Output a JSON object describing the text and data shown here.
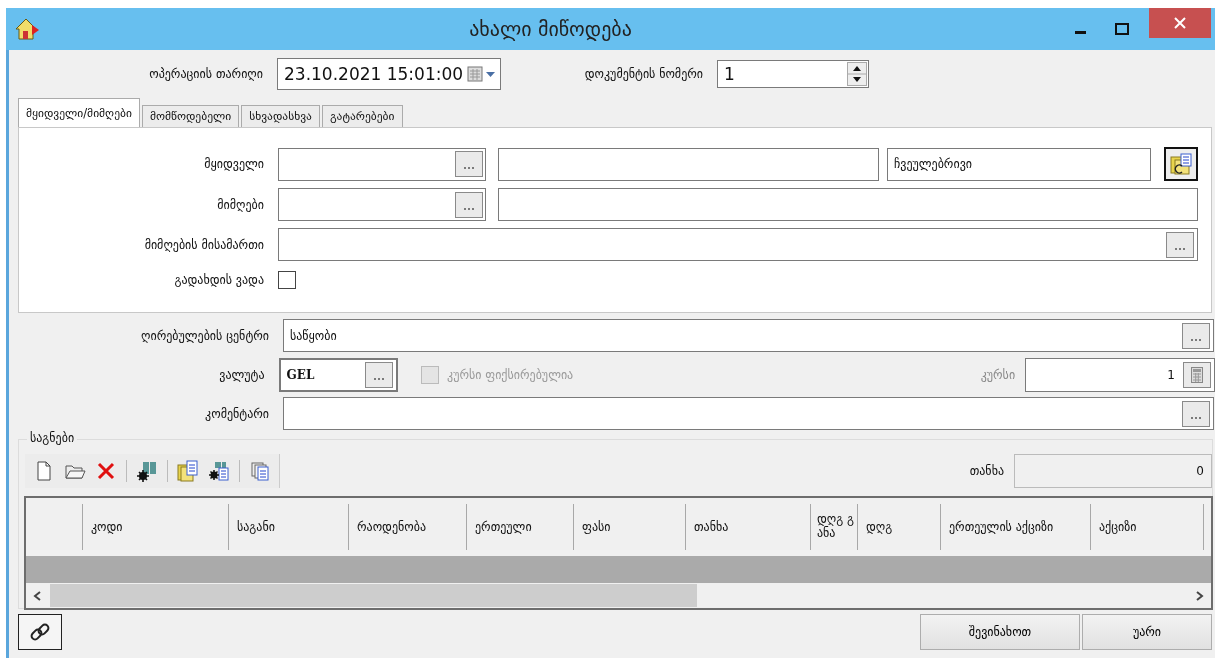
{
  "window": {
    "title": "ახალი მიწოდება"
  },
  "header": {
    "operation_date_label": "ოპერაციის თარიღი",
    "operation_date": "23.10.2021 15:01:00",
    "document_number_label": "დოკუმენტის ნომერი",
    "document_number": "1"
  },
  "tabs": [
    {
      "label": "მყიდველი/მიმღები",
      "selected": true
    },
    {
      "label": "მომწოდებელი",
      "selected": false
    },
    {
      "label": "სხვადასხვა",
      "selected": false
    },
    {
      "label": "გატარებები",
      "selected": false
    }
  ],
  "buyer_tab": {
    "buyer_label": "მყიდველი",
    "buyer_type": "ჩვეულებრივი",
    "receiver_label": "მიმღები",
    "receiver_address_label": "მიმღების მისამართი",
    "payment_term_label": "გადახდის ვადა",
    "payment_term_checked": false
  },
  "cost_center": {
    "label": "ღირებულების ცენტრი",
    "value": "საწყობი"
  },
  "currency": {
    "label": "ვალუტა",
    "value": "GEL",
    "fixed_rate_label": "კურსი ფიქსირებულია",
    "fixed_rate_checked": false,
    "fixed_rate_disabled": true,
    "rate_label": "კურსი",
    "rate": "1"
  },
  "comment": {
    "label": "კომენტარი"
  },
  "items": {
    "title": "საგნები",
    "total_label": "თანხა",
    "total": "0",
    "columns": [
      "კოდი",
      "საგანი",
      "რაოდენობა",
      "ერთეული",
      "ფასი",
      "თანხა",
      "დღგ განა",
      "დღგ",
      "ერთეულის აქციზი",
      "აქციზი"
    ]
  },
  "buttons": [
    {
      "label": "შევინახოთ"
    },
    {
      "label": "უარი"
    }
  ]
}
